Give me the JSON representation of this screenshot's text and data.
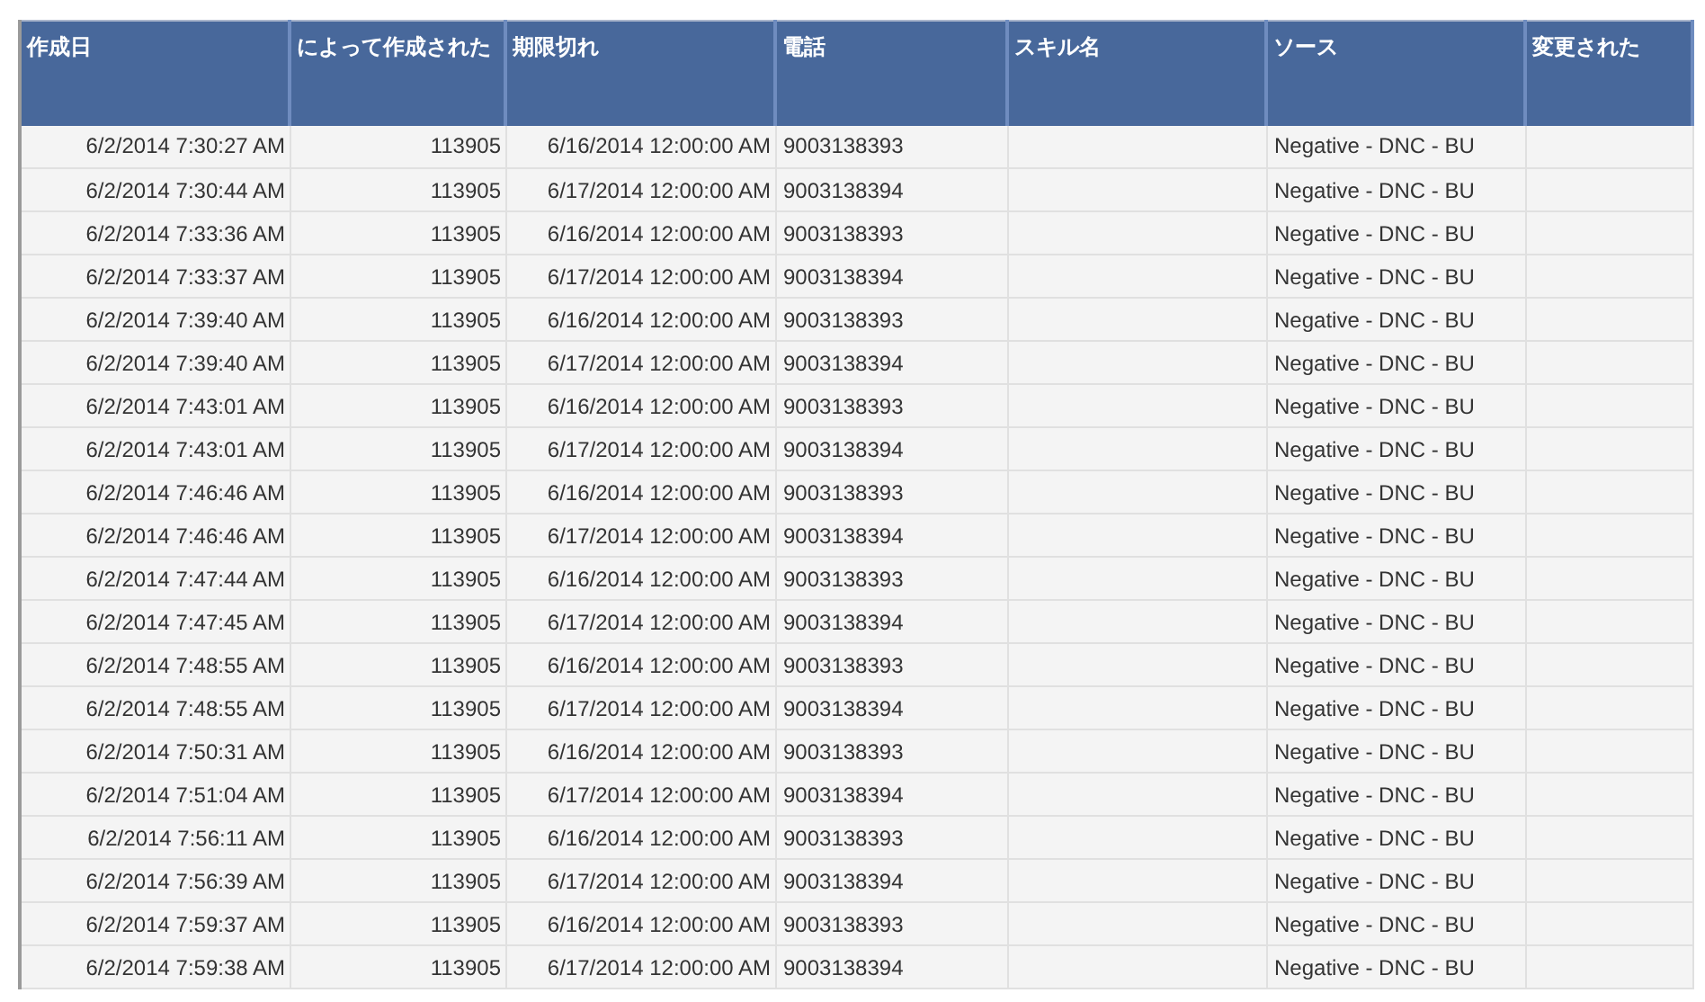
{
  "table": {
    "columns": [
      "作成日",
      "によって作成された",
      "期限切れ",
      "電話",
      "スキル名",
      "ソース",
      "変更された"
    ],
    "rows": [
      {
        "created": "6/2/2014 7:30:27 AM",
        "created_by": "113905",
        "expires": "6/16/2014 12:00:00 AM",
        "phone": "9003138393",
        "source": "Negative - DNC - BU"
      },
      {
        "created": "6/2/2014 7:30:44 AM",
        "created_by": "113905",
        "expires": "6/17/2014 12:00:00 AM",
        "phone": "9003138394",
        "source": "Negative - DNC - BU"
      },
      {
        "created": "6/2/2014 7:33:36 AM",
        "created_by": "113905",
        "expires": "6/16/2014 12:00:00 AM",
        "phone": "9003138393",
        "source": "Negative - DNC - BU"
      },
      {
        "created": "6/2/2014 7:33:37 AM",
        "created_by": "113905",
        "expires": "6/17/2014 12:00:00 AM",
        "phone": "9003138394",
        "source": "Negative - DNC - BU"
      },
      {
        "created": "6/2/2014 7:39:40 AM",
        "created_by": "113905",
        "expires": "6/16/2014 12:00:00 AM",
        "phone": "9003138393",
        "source": "Negative - DNC - BU"
      },
      {
        "created": "6/2/2014 7:39:40 AM",
        "created_by": "113905",
        "expires": "6/17/2014 12:00:00 AM",
        "phone": "9003138394",
        "source": "Negative - DNC - BU"
      },
      {
        "created": "6/2/2014 7:43:01 AM",
        "created_by": "113905",
        "expires": "6/16/2014 12:00:00 AM",
        "phone": "9003138393",
        "source": "Negative - DNC - BU"
      },
      {
        "created": "6/2/2014 7:43:01 AM",
        "created_by": "113905",
        "expires": "6/17/2014 12:00:00 AM",
        "phone": "9003138394",
        "source": "Negative - DNC - BU"
      },
      {
        "created": "6/2/2014 7:46:46 AM",
        "created_by": "113905",
        "expires": "6/16/2014 12:00:00 AM",
        "phone": "9003138393",
        "source": "Negative - DNC - BU"
      },
      {
        "created": "6/2/2014 7:46:46 AM",
        "created_by": "113905",
        "expires": "6/17/2014 12:00:00 AM",
        "phone": "9003138394",
        "source": "Negative - DNC - BU"
      },
      {
        "created": "6/2/2014 7:47:44 AM",
        "created_by": "113905",
        "expires": "6/16/2014 12:00:00 AM",
        "phone": "9003138393",
        "source": "Negative - DNC - BU"
      },
      {
        "created": "6/2/2014 7:47:45 AM",
        "created_by": "113905",
        "expires": "6/17/2014 12:00:00 AM",
        "phone": "9003138394",
        "source": "Negative - DNC - BU"
      },
      {
        "created": "6/2/2014 7:48:55 AM",
        "created_by": "113905",
        "expires": "6/16/2014 12:00:00 AM",
        "phone": "9003138393",
        "source": "Negative - DNC - BU"
      },
      {
        "created": "6/2/2014 7:48:55 AM",
        "created_by": "113905",
        "expires": "6/17/2014 12:00:00 AM",
        "phone": "9003138394",
        "source": "Negative - DNC - BU"
      },
      {
        "created": "6/2/2014 7:50:31 AM",
        "created_by": "113905",
        "expires": "6/16/2014 12:00:00 AM",
        "phone": "9003138393",
        "source": "Negative - DNC - BU"
      },
      {
        "created": "6/2/2014 7:51:04 AM",
        "created_by": "113905",
        "expires": "6/17/2014 12:00:00 AM",
        "phone": "9003138394",
        "source": "Negative - DNC - BU"
      },
      {
        "created": "6/2/2014 7:56:11 AM",
        "created_by": "113905",
        "expires": "6/16/2014 12:00:00 AM",
        "phone": "9003138393",
        "source": "Negative - DNC - BU"
      },
      {
        "created": "6/2/2014 7:56:39 AM",
        "created_by": "113905",
        "expires": "6/17/2014 12:00:00 AM",
        "phone": "9003138394",
        "source": "Negative - DNC - BU"
      },
      {
        "created": "6/2/2014 7:59:37 AM",
        "created_by": "113905",
        "expires": "6/16/2014 12:00:00 AM",
        "phone": "9003138393",
        "source": "Negative - DNC - BU"
      },
      {
        "created": "6/2/2014 7:59:38 AM",
        "created_by": "113905",
        "expires": "6/17/2014 12:00:00 AM",
        "phone": "9003138394",
        "source": "Negative - DNC - BU"
      }
    ]
  }
}
